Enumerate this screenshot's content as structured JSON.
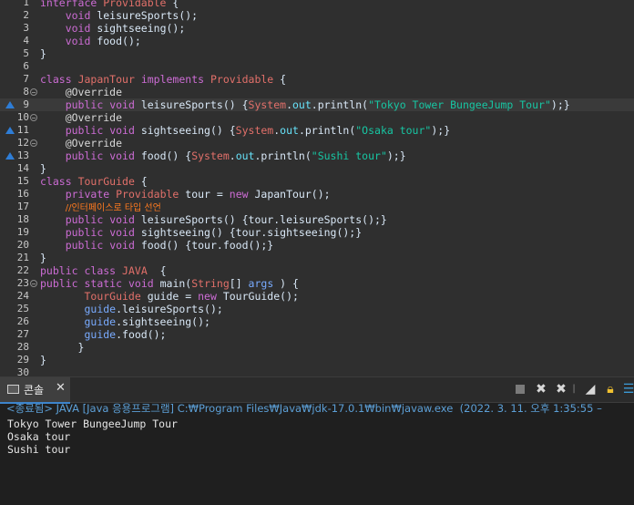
{
  "editor": {
    "line_numbers": [
      "1",
      "2",
      "3",
      "4",
      "5",
      "6",
      "7",
      "8",
      "9",
      "10",
      "11",
      "12",
      "13",
      "14",
      "15",
      "16",
      "17",
      "18",
      "19",
      "20",
      "21",
      "22",
      "23",
      "24",
      "25",
      "26",
      "27",
      "28",
      "29",
      "30"
    ],
    "tokens": {
      "interface": "interface",
      "Providable": "Providable",
      "brace_open": " {",
      "void": "void",
      "leisureSports_decl": " leisureSports();",
      "sightseeing_decl": " sightseeing();",
      "food_decl": " food();",
      "brace_close": "}",
      "class": "class",
      "JapanTour": "JapanTour",
      "implements": "implements",
      "override": "@Override",
      "public": "public",
      "leisureSports_sig": " leisureSports() {",
      "System": "System",
      "out": "out",
      "println_open": ".println(",
      "str_tokyo": "\"Tokyo Tower BungeeJump Tour\"",
      "close_call": ");}",
      "sightseeing_sig": " sightseeing() {",
      "str_osaka": "\"Osaka tour\"",
      "food_sig": " food() {",
      "str_sushi": "\"Sushi tour\"",
      "TourGuide": "TourGuide",
      "private": "private",
      "tour_field": " tour",
      "eq_new": " = ",
      "new": "new",
      "JapanTour_ctor": " JapanTour();",
      "comment_kr": "//인터페이스로 타입 선언",
      "tour": "tour",
      "call_leisure": ".leisureSports();}",
      "call_sight": ".sightseeing();}",
      "call_food": ".food();}",
      "JAVA": "JAVA",
      "static": "static",
      "main": " main(",
      "String": "String",
      "arr_args": "[] ",
      "args": "args",
      "main_close": " ) {",
      "guide": "guide",
      "TourGuide_ctor": " TourGuide();",
      "guide_leisure": ".leisureSports();",
      "guide_sight": ".sightseeing();",
      "guide_food": ".food();",
      "dot": "."
    }
  },
  "console_view": {
    "tab_label": "콘솔",
    "tab_close": "✕",
    "status": "<종료됨> JAVA [Java 응용프로그램] C:₩Program Files₩Java₩jdk-17.0.1₩bin₩javaw.exe  (2022. 3. 11. 오후 1:35:55 –",
    "output": [
      "Tokyo Tower BungeeJump Tour",
      "Osaka tour",
      "Sushi tour"
    ]
  },
  "icons": {
    "console": "console-icon",
    "stop": "stop-icon",
    "remove": "remove-launch-icon",
    "remove_all": "remove-all-terminated-icon",
    "clear": "clear-console-icon",
    "scroll_lock": "scroll-lock-icon",
    "menu": "view-menu-icon"
  },
  "colors": {
    "editor_bg": "#2f2f2f",
    "keyword": "#cc6cd4",
    "string": "#17c6a3",
    "class_name": "#e2706a",
    "comment": "#ff7a1f",
    "status_link": "#5c9fd6",
    "console_bg": "#1f1f1f"
  }
}
